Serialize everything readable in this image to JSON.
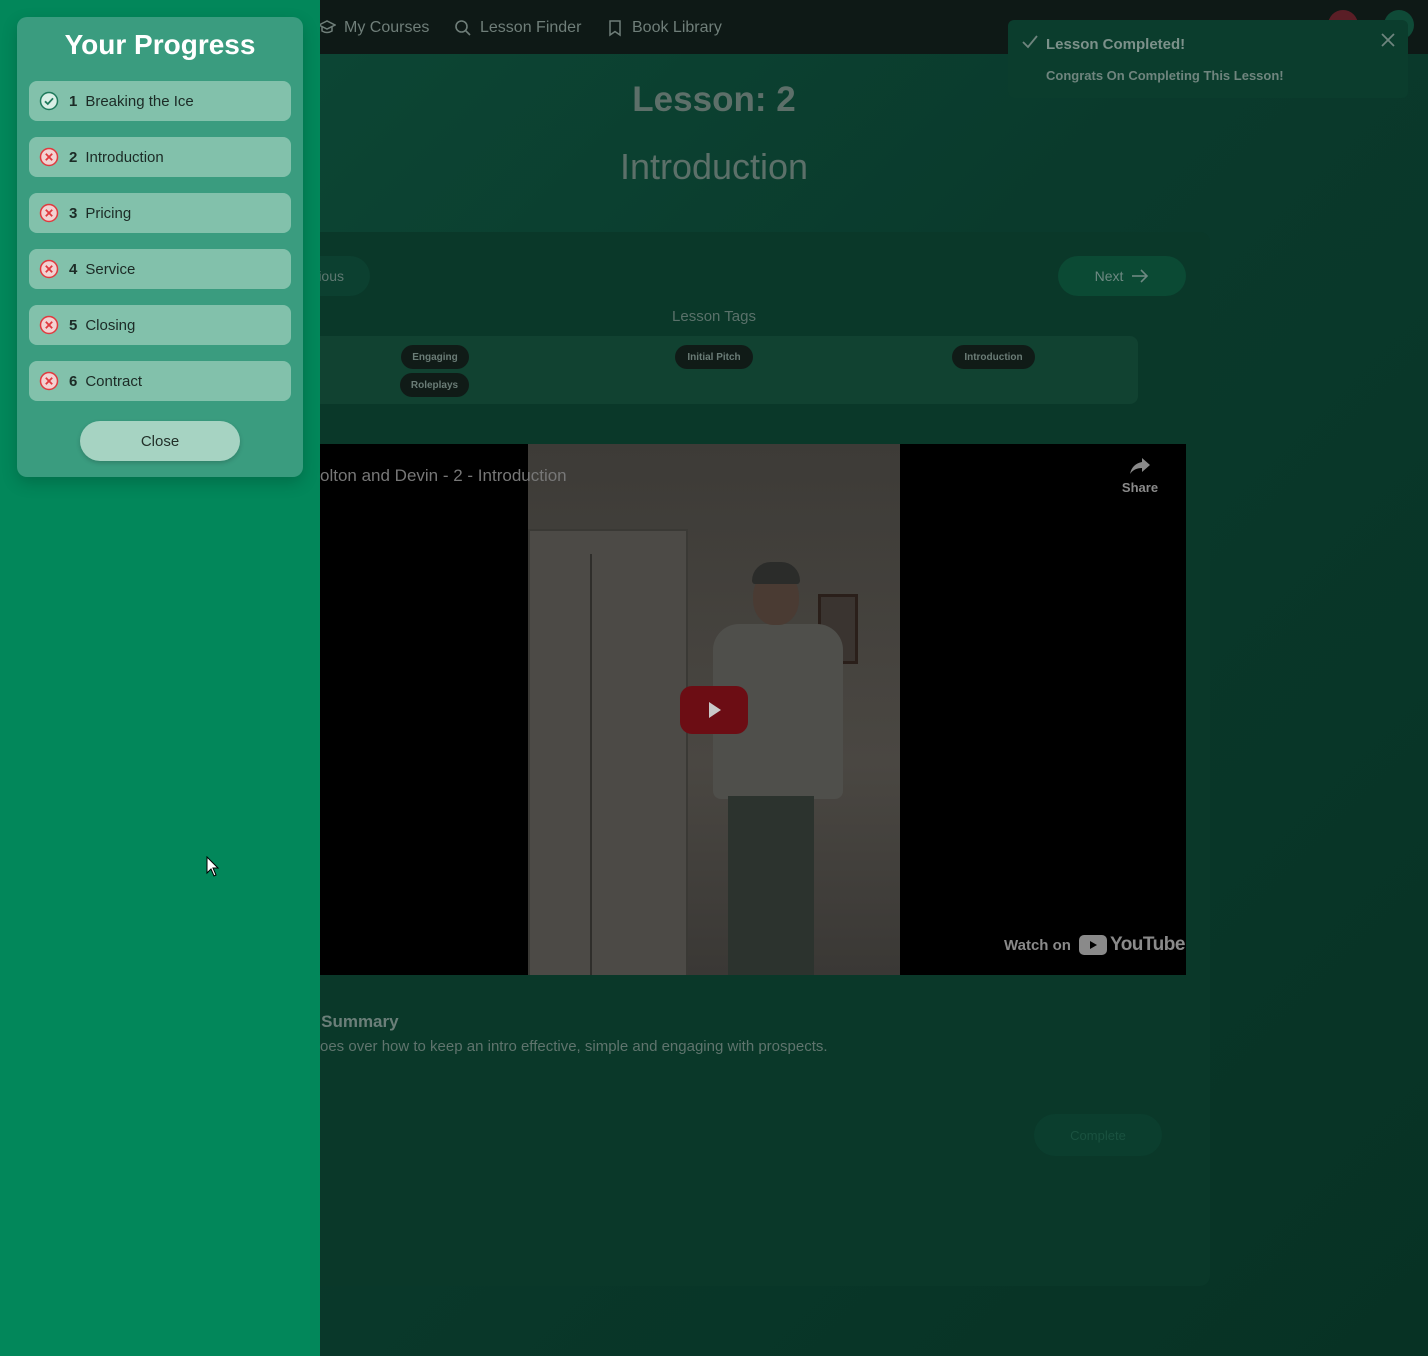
{
  "nav": {
    "items": [
      {
        "label": "My Courses",
        "icon": "cap-icon"
      },
      {
        "label": "Lesson Finder",
        "icon": "search-icon"
      },
      {
        "label": "Book Library",
        "icon": "bookmark-icon"
      }
    ]
  },
  "toast": {
    "title": "Lesson Completed!",
    "message": "Congrats On Completing This Lesson!"
  },
  "lesson": {
    "number_label": "Lesson: 2",
    "title": "Introduction",
    "prev_label": "ious",
    "next_label": "Next",
    "tags_label": "Lesson Tags",
    "tags": [
      "Engaging",
      "Initial Pitch",
      "Introduction",
      "Roleplays"
    ]
  },
  "video": {
    "title": "olton and Devin - 2 - Introduction",
    "share_label": "Share",
    "watch_on_label": "Watch on",
    "youtube_label": "YouTube"
  },
  "summary": {
    "heading": "n Summary",
    "text": "oes over how to keep an intro effective, simple and engaging with prospects."
  },
  "complete_button": {
    "label": "Complete"
  },
  "progress": {
    "title": "Your Progress",
    "items": [
      {
        "num": "1",
        "label": "Breaking the Ice",
        "status": "complete"
      },
      {
        "num": "2",
        "label": "Introduction",
        "status": "incomplete"
      },
      {
        "num": "3",
        "label": "Pricing",
        "status": "incomplete"
      },
      {
        "num": "4",
        "label": "Service",
        "status": "incomplete"
      },
      {
        "num": "5",
        "label": "Closing",
        "status": "incomplete"
      },
      {
        "num": "6",
        "label": "Contract",
        "status": "incomplete"
      }
    ],
    "close_label": "Close"
  },
  "colors": {
    "sidebar": "#02875a",
    "panel": "#3a9c7f",
    "item": "#82c1ab",
    "complete_status": "#1f7a5c",
    "incomplete_status": "#e03a3f"
  }
}
